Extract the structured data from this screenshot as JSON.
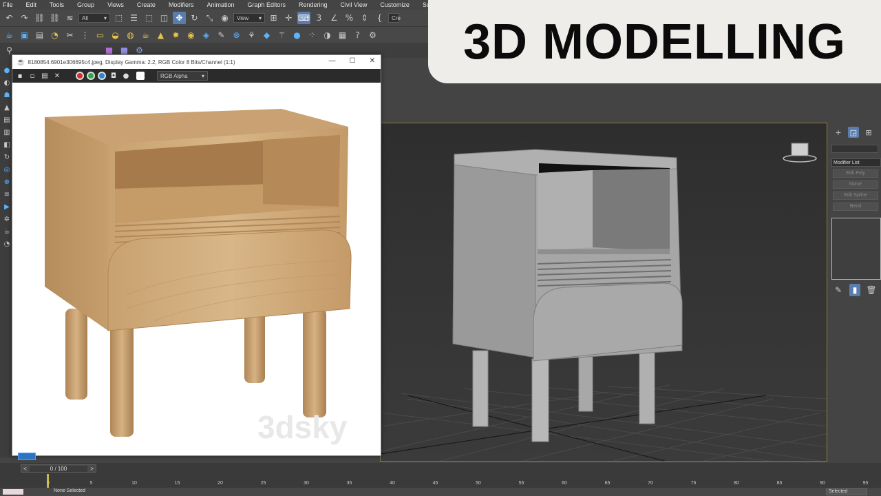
{
  "menu": {
    "items": [
      "File",
      "Edit",
      "Tools",
      "Group",
      "Views",
      "Create",
      "Modifiers",
      "Animation",
      "Graph Editors",
      "Rendering",
      "Civil View",
      "Customize",
      "Scripting"
    ]
  },
  "toolbar": {
    "selection_filter": "All",
    "reference_coord": "View",
    "named_sel": "Cre"
  },
  "framebuffer": {
    "title": "8180854.6901e306695c4.jpeg, Display Gamma: 2.2, RGB Color 8 Bits/Channel (1:1)",
    "channel": "RGB Alpha",
    "watermark": "3dsky",
    "swatch_colors": [
      "#d92b2b",
      "#2ea84a",
      "#2a86d6"
    ]
  },
  "banner": {
    "text": "3D MODELLING"
  },
  "command_panel": {
    "modifier_list": "Modifier List",
    "buttons": [
      "Edit Poly",
      "Noise",
      "Edit Spline",
      "Bend"
    ]
  },
  "timeline": {
    "frame_display": "0 / 100",
    "prev": "<",
    "next": ">",
    "ticks": [
      "0",
      "5",
      "10",
      "15",
      "20",
      "25",
      "30",
      "35",
      "40",
      "45",
      "50",
      "55",
      "60",
      "65",
      "70",
      "75",
      "80",
      "85",
      "90",
      "95"
    ]
  },
  "status": {
    "left_text": "None Selected",
    "selection_set": "Selected"
  },
  "colors": {
    "viewport_border": "#8c7f3a",
    "accent_blue": "#2d74c4"
  }
}
